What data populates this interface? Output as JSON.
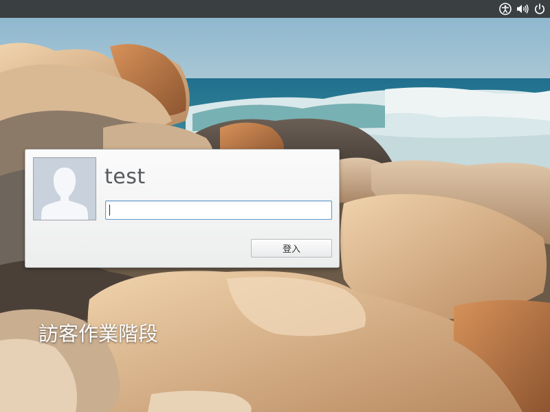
{
  "panel": {
    "icons": [
      "accessibility-icon",
      "volume-icon",
      "power-icon"
    ]
  },
  "login_dialog": {
    "username": "test",
    "password_value": "",
    "login_button_label": "登入",
    "avatar": "default-user-avatar"
  },
  "guest_session_label": "訪客作業階段",
  "colors": {
    "panel": "#3a3f41",
    "focus_border": "#5b9bd5",
    "dialog_bg": "#f3f4f4"
  }
}
